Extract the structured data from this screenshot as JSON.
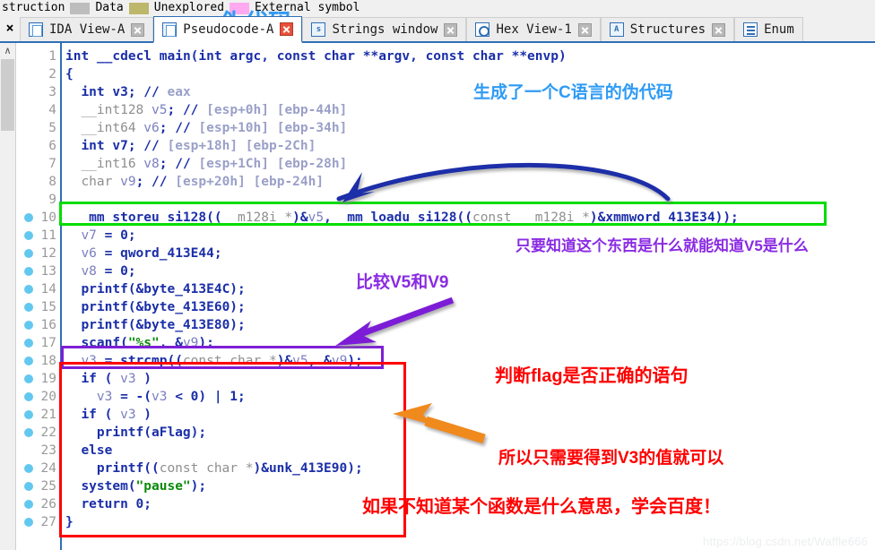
{
  "legend": {
    "lead_text": "struction",
    "items": [
      {
        "label": "Data",
        "color": "#bdbdbd"
      },
      {
        "label": "Unexplored",
        "color": "#bdb76b"
      },
      {
        "label": "External symbol",
        "color": "#ffaaf0"
      }
    ]
  },
  "tabbar": {
    "close_strip_glyph": "×",
    "tabs": [
      {
        "label": "IDA View-A",
        "icon": "document-icon",
        "close": "close-icon",
        "active": false
      },
      {
        "label": "Pseudocode-A",
        "icon": "document-icon",
        "close": "close-icon-red",
        "active": true
      },
      {
        "label": "Strings window",
        "icon": "strings-icon",
        "close": "close-icon",
        "active": false
      },
      {
        "label": "Hex View-1",
        "icon": "hex-icon",
        "close": "close-icon",
        "active": false
      },
      {
        "label": "Structures",
        "icon": "structures-icon",
        "close": "close-icon",
        "active": false
      },
      {
        "label": "Enum",
        "icon": "enums-icon",
        "close": "",
        "active": false
      }
    ]
  },
  "scrollbar": {
    "up_glyph": "∧"
  },
  "code": {
    "language": "c-pseudocode",
    "lines": [
      {
        "n": 1,
        "bp": false,
        "indent": 0,
        "tokens": [
          {
            "t": "int __cdecl main(int argc, const char **argv, const char **envp)",
            "c": "plain"
          }
        ]
      },
      {
        "n": 2,
        "bp": false,
        "indent": 0,
        "tokens": [
          {
            "t": "{",
            "c": "plain"
          }
        ]
      },
      {
        "n": 3,
        "bp": false,
        "indent": 1,
        "tokens": [
          {
            "t": "int v3; ",
            "c": "plain"
          },
          {
            "t": "// ",
            "c": "cmk"
          },
          {
            "t": "eax",
            "c": "cm"
          }
        ]
      },
      {
        "n": 4,
        "bp": false,
        "indent": 1,
        "tokens": [
          {
            "t": "__int128 ",
            "c": "typ"
          },
          {
            "t": "v5",
            "c": "var"
          },
          {
            "t": "; ",
            "c": "plain"
          },
          {
            "t": "// ",
            "c": "cmk"
          },
          {
            "t": "[esp+0h] [ebp-44h]",
            "c": "cm"
          }
        ]
      },
      {
        "n": 5,
        "bp": false,
        "indent": 1,
        "tokens": [
          {
            "t": "__int64 ",
            "c": "typ"
          },
          {
            "t": "v6",
            "c": "var"
          },
          {
            "t": "; ",
            "c": "plain"
          },
          {
            "t": "// ",
            "c": "cmk"
          },
          {
            "t": "[esp+10h] [ebp-34h]",
            "c": "cm"
          }
        ]
      },
      {
        "n": 6,
        "bp": false,
        "indent": 1,
        "tokens": [
          {
            "t": "int v7; ",
            "c": "plain"
          },
          {
            "t": "// ",
            "c": "cmk"
          },
          {
            "t": "[esp+18h] [ebp-2Ch]",
            "c": "cm"
          }
        ]
      },
      {
        "n": 7,
        "bp": false,
        "indent": 1,
        "tokens": [
          {
            "t": "__int16 ",
            "c": "typ"
          },
          {
            "t": "v8",
            "c": "var"
          },
          {
            "t": "; ",
            "c": "plain"
          },
          {
            "t": "// ",
            "c": "cmk"
          },
          {
            "t": "[esp+1Ch] [ebp-28h]",
            "c": "cm"
          }
        ]
      },
      {
        "n": 8,
        "bp": false,
        "indent": 1,
        "tokens": [
          {
            "t": "char ",
            "c": "typ"
          },
          {
            "t": "v9",
            "c": "var"
          },
          {
            "t": "; ",
            "c": "plain"
          },
          {
            "t": "// ",
            "c": "cmk"
          },
          {
            "t": "[esp+20h] [ebp-24h]",
            "c": "cm"
          }
        ]
      },
      {
        "n": 9,
        "bp": false,
        "indent": 0,
        "tokens": [
          {
            "t": "",
            "c": "plain"
          }
        ]
      },
      {
        "n": 10,
        "bp": true,
        "indent": 1,
        "tokens": [
          {
            "t": "_mm_storeu_si128((",
            "c": "plain"
          },
          {
            "t": "__m128i *",
            "c": "typ"
          },
          {
            "t": ")&",
            "c": "plain"
          },
          {
            "t": "v5",
            "c": "var"
          },
          {
            "t": ", _mm_loadu_si128((",
            "c": "plain"
          },
          {
            "t": "const __m128i *",
            "c": "typ"
          },
          {
            "t": ")&xmmword_413E34));",
            "c": "plain"
          }
        ]
      },
      {
        "n": 11,
        "bp": true,
        "indent": 1,
        "tokens": [
          {
            "t": "v7",
            "c": "var"
          },
          {
            "t": " = 0;",
            "c": "plain"
          }
        ]
      },
      {
        "n": 12,
        "bp": true,
        "indent": 1,
        "tokens": [
          {
            "t": "v6",
            "c": "var"
          },
          {
            "t": " = qword_413E44;",
            "c": "plain"
          }
        ]
      },
      {
        "n": 13,
        "bp": true,
        "indent": 1,
        "tokens": [
          {
            "t": "v8",
            "c": "var"
          },
          {
            "t": " = 0;",
            "c": "plain"
          }
        ]
      },
      {
        "n": 14,
        "bp": true,
        "indent": 1,
        "tokens": [
          {
            "t": "printf(&byte_413E4C);",
            "c": "plain"
          }
        ]
      },
      {
        "n": 15,
        "bp": true,
        "indent": 1,
        "tokens": [
          {
            "t": "printf(&byte_413E60);",
            "c": "plain"
          }
        ]
      },
      {
        "n": 16,
        "bp": true,
        "indent": 1,
        "tokens": [
          {
            "t": "printf(&byte_413E80);",
            "c": "plain"
          }
        ]
      },
      {
        "n": 17,
        "bp": true,
        "indent": 1,
        "tokens": [
          {
            "t": "scanf(",
            "c": "plain"
          },
          {
            "t": "\"%s\"",
            "c": "str"
          },
          {
            "t": ", &",
            "c": "plain"
          },
          {
            "t": "v9",
            "c": "var"
          },
          {
            "t": ");",
            "c": "plain"
          }
        ]
      },
      {
        "n": 18,
        "bp": true,
        "indent": 1,
        "tokens": [
          {
            "t": "v3",
            "c": "var"
          },
          {
            "t": " = strcmp((",
            "c": "plain"
          },
          {
            "t": "const char *",
            "c": "typ"
          },
          {
            "t": ")&",
            "c": "plain"
          },
          {
            "t": "v5",
            "c": "var"
          },
          {
            "t": ", &",
            "c": "plain"
          },
          {
            "t": "v9",
            "c": "var"
          },
          {
            "t": ");",
            "c": "plain"
          }
        ]
      },
      {
        "n": 19,
        "bp": true,
        "indent": 1,
        "tokens": [
          {
            "t": "if ( ",
            "c": "plain"
          },
          {
            "t": "v3",
            "c": "var"
          },
          {
            "t": " )",
            "c": "plain"
          }
        ]
      },
      {
        "n": 20,
        "bp": true,
        "indent": 2,
        "tokens": [
          {
            "t": "v3",
            "c": "var"
          },
          {
            "t": " = -(",
            "c": "plain"
          },
          {
            "t": "v3",
            "c": "var"
          },
          {
            "t": " < 0) | 1;",
            "c": "plain"
          }
        ]
      },
      {
        "n": 21,
        "bp": true,
        "indent": 1,
        "tokens": [
          {
            "t": "if ( ",
            "c": "plain"
          },
          {
            "t": "v3",
            "c": "var"
          },
          {
            "t": " )",
            "c": "plain"
          }
        ]
      },
      {
        "n": 22,
        "bp": true,
        "indent": 2,
        "tokens": [
          {
            "t": "printf(aFlag);",
            "c": "plain"
          }
        ]
      },
      {
        "n": 23,
        "bp": false,
        "indent": 1,
        "tokens": [
          {
            "t": "else",
            "c": "plain"
          }
        ]
      },
      {
        "n": 24,
        "bp": true,
        "indent": 2,
        "tokens": [
          {
            "t": "printf((",
            "c": "plain"
          },
          {
            "t": "const char *",
            "c": "typ"
          },
          {
            "t": ")&unk_413E90);",
            "c": "plain"
          }
        ]
      },
      {
        "n": 25,
        "bp": true,
        "indent": 1,
        "tokens": [
          {
            "t": "system(",
            "c": "plain"
          },
          {
            "t": "\"pause\"",
            "c": "str"
          },
          {
            "t": ");",
            "c": "plain"
          }
        ]
      },
      {
        "n": 26,
        "bp": true,
        "indent": 1,
        "tokens": [
          {
            "t": "return 0;",
            "c": "plain"
          }
        ]
      },
      {
        "n": 27,
        "bp": true,
        "indent": 0,
        "tokens": [
          {
            "t": "}",
            "c": "plain"
          }
        ]
      }
    ]
  },
  "annotations": {
    "pseudocode_overlay": "伪代码",
    "c_generated": "生成了一个C语言的伪代码",
    "know_v5": "只要知道这个东西是什么就能知道V5是什么",
    "compare_v5_v9": "比较V5和V9",
    "flag_check": "判断flag是否正确的语句",
    "only_need_v3": "所以只需要得到V3的值就可以",
    "baidu_tip": "如果不知道某个函数是什么意思，学会百度！",
    "boxes": [
      {
        "name": "line-10-highlight-box",
        "color": "#00dd00"
      },
      {
        "name": "line-18-highlight-box",
        "color": "#7d1fd6"
      },
      {
        "name": "flag-branch-highlight-box",
        "color": "#ff0000"
      }
    ],
    "arrows": [
      {
        "name": "blue-arrow-to-line-10",
        "color": "#1f2fa8"
      },
      {
        "name": "purple-arrow-to-line-18",
        "color": "#7d1fd6"
      },
      {
        "name": "orange-arrow-to-red-box",
        "color": "#f08a1e"
      }
    ]
  },
  "watermark": "https://blog.csdn.net/Waffle666"
}
